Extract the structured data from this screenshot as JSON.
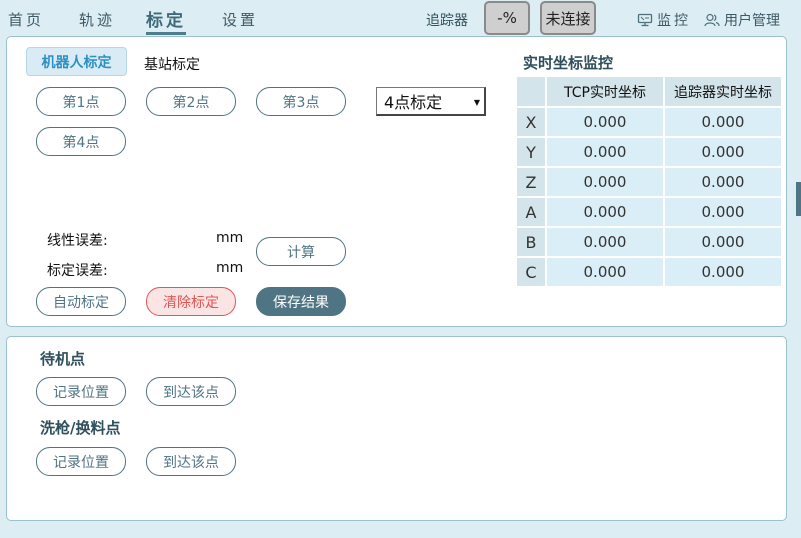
{
  "nav": {
    "home": "首页",
    "track": "轨迹",
    "calibration": "标定",
    "settings": "设置"
  },
  "topbar": {
    "tracker_label": "追踪器",
    "percent_btn": "-%",
    "connect_btn": "未连接",
    "monitor": "监控",
    "user_mgmt": "用户管理"
  },
  "calib": {
    "tab_robot": "机器人标定",
    "tab_base": "基站标定",
    "point1": "第1点",
    "point2": "第2点",
    "point3": "第3点",
    "point4": "第4点",
    "mode_selected": "4点标定",
    "linear_error_label": "线性误差:",
    "calib_error_label": "标定误差:",
    "unit1": "mm",
    "unit2": "mm",
    "compute": "计算",
    "auto_calib": "自动标定",
    "clear_calib": "清除标定",
    "save_result": "保存结果"
  },
  "monitor": {
    "title": "实时坐标监控",
    "col_tcp": "TCP实时坐标",
    "col_tracker": "追踪器实时坐标",
    "rows": [
      {
        "axis": "X",
        "tcp": "0.000",
        "tracker": "0.000"
      },
      {
        "axis": "Y",
        "tcp": "0.000",
        "tracker": "0.000"
      },
      {
        "axis": "Z",
        "tcp": "0.000",
        "tracker": "0.000"
      },
      {
        "axis": "A",
        "tcp": "0.000",
        "tracker": "0.000"
      },
      {
        "axis": "B",
        "tcp": "0.000",
        "tracker": "0.000"
      },
      {
        "axis": "C",
        "tcp": "0.000",
        "tracker": "0.000"
      }
    ]
  },
  "standby": {
    "title": "待机点",
    "record": "记录位置",
    "goto": "到达该点"
  },
  "gunwash": {
    "title": "洗枪/换料点",
    "record": "记录位置",
    "goto": "到达该点"
  },
  "colors": {
    "accent": "#4f7483",
    "active_tab": "#2e8fc2",
    "danger": "#e05555",
    "background": "#dcedf3"
  }
}
